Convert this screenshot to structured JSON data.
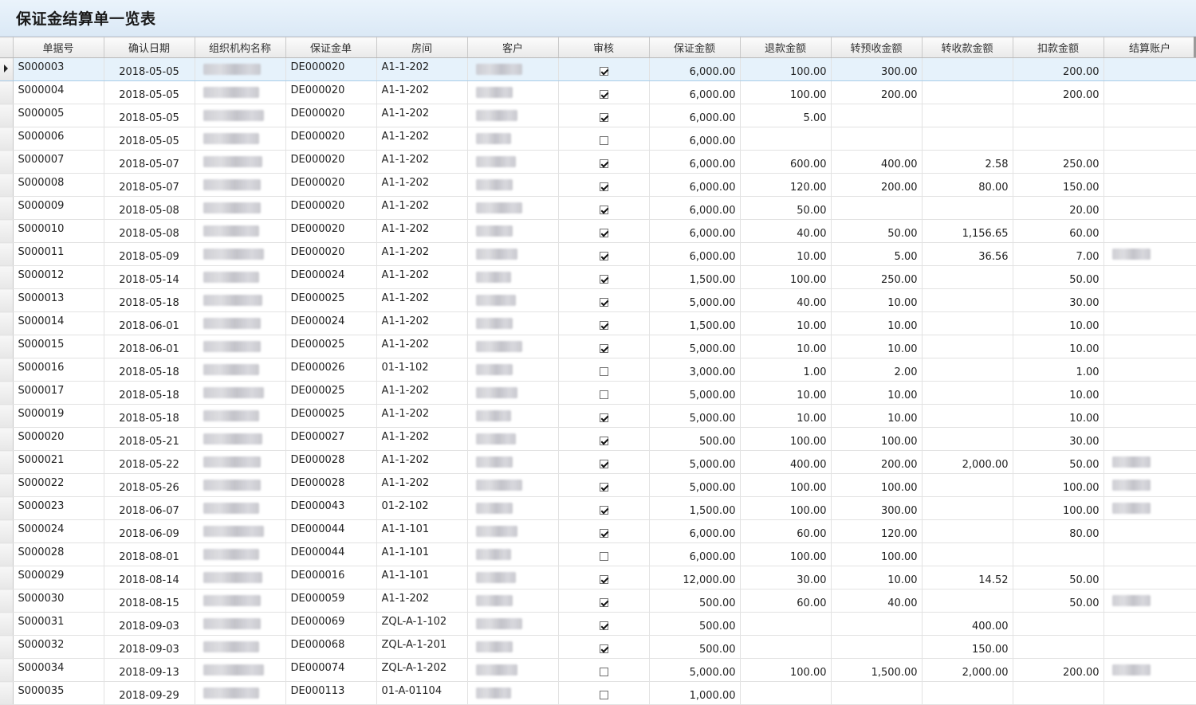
{
  "window": {
    "title": "保证金结算单一览表"
  },
  "columns": [
    "单据号",
    "确认日期",
    "组织机构名称",
    "保证金单",
    "房间",
    "客户",
    "审核",
    "保证金额",
    "退款金额",
    "转预收金额",
    "转收款金额",
    "扣款金额",
    "结算账户"
  ],
  "rows": [
    {
      "code": "S000003",
      "date": "2018-05-05",
      "deposit_no": "DE000020",
      "room": "A1-1-202",
      "approved": true,
      "amount": "6,000.00",
      "refund": "100.00",
      "to_prepaid": "300.00",
      "to_receipt": "",
      "deduct": "200.00",
      "account_masked": false
    },
    {
      "code": "S000004",
      "date": "2018-05-05",
      "deposit_no": "DE000020",
      "room": "A1-1-202",
      "approved": true,
      "amount": "6,000.00",
      "refund": "100.00",
      "to_prepaid": "200.00",
      "to_receipt": "",
      "deduct": "200.00",
      "account_masked": false
    },
    {
      "code": "S000005",
      "date": "2018-05-05",
      "deposit_no": "DE000020",
      "room": "A1-1-202",
      "approved": true,
      "amount": "6,000.00",
      "refund": "5.00",
      "to_prepaid": "",
      "to_receipt": "",
      "deduct": "",
      "account_masked": false
    },
    {
      "code": "S000006",
      "date": "2018-05-05",
      "deposit_no": "DE000020",
      "room": "A1-1-202",
      "approved": false,
      "amount": "6,000.00",
      "refund": "",
      "to_prepaid": "",
      "to_receipt": "",
      "deduct": "",
      "account_masked": false
    },
    {
      "code": "S000007",
      "date": "2018-05-07",
      "deposit_no": "DE000020",
      "room": "A1-1-202",
      "approved": true,
      "amount": "6,000.00",
      "refund": "600.00",
      "to_prepaid": "400.00",
      "to_receipt": "2.58",
      "deduct": "250.00",
      "account_masked": false
    },
    {
      "code": "S000008",
      "date": "2018-05-07",
      "deposit_no": "DE000020",
      "room": "A1-1-202",
      "approved": true,
      "amount": "6,000.00",
      "refund": "120.00",
      "to_prepaid": "200.00",
      "to_receipt": "80.00",
      "deduct": "150.00",
      "account_masked": false
    },
    {
      "code": "S000009",
      "date": "2018-05-08",
      "deposit_no": "DE000020",
      "room": "A1-1-202",
      "approved": true,
      "amount": "6,000.00",
      "refund": "50.00",
      "to_prepaid": "",
      "to_receipt": "",
      "deduct": "20.00",
      "account_masked": false
    },
    {
      "code": "S000010",
      "date": "2018-05-08",
      "deposit_no": "DE000020",
      "room": "A1-1-202",
      "approved": true,
      "amount": "6,000.00",
      "refund": "40.00",
      "to_prepaid": "50.00",
      "to_receipt": "1,156.65",
      "deduct": "60.00",
      "account_masked": false
    },
    {
      "code": "S000011",
      "date": "2018-05-09",
      "deposit_no": "DE000020",
      "room": "A1-1-202",
      "approved": true,
      "amount": "6,000.00",
      "refund": "10.00",
      "to_prepaid": "5.00",
      "to_receipt": "36.56",
      "deduct": "7.00",
      "account_masked": true
    },
    {
      "code": "S000012",
      "date": "2018-05-14",
      "deposit_no": "DE000024",
      "room": "A1-1-202",
      "approved": true,
      "amount": "1,500.00",
      "refund": "100.00",
      "to_prepaid": "250.00",
      "to_receipt": "",
      "deduct": "50.00",
      "account_masked": false
    },
    {
      "code": "S000013",
      "date": "2018-05-18",
      "deposit_no": "DE000025",
      "room": "A1-1-202",
      "approved": true,
      "amount": "5,000.00",
      "refund": "40.00",
      "to_prepaid": "10.00",
      "to_receipt": "",
      "deduct": "30.00",
      "account_masked": false
    },
    {
      "code": "S000014",
      "date": "2018-06-01",
      "deposit_no": "DE000024",
      "room": "A1-1-202",
      "approved": true,
      "amount": "1,500.00",
      "refund": "10.00",
      "to_prepaid": "10.00",
      "to_receipt": "",
      "deduct": "10.00",
      "account_masked": false
    },
    {
      "code": "S000015",
      "date": "2018-06-01",
      "deposit_no": "DE000025",
      "room": "A1-1-202",
      "approved": true,
      "amount": "5,000.00",
      "refund": "10.00",
      "to_prepaid": "10.00",
      "to_receipt": "",
      "deduct": "10.00",
      "account_masked": false
    },
    {
      "code": "S000016",
      "date": "2018-05-18",
      "deposit_no": "DE000026",
      "room": "01-1-102",
      "approved": false,
      "amount": "3,000.00",
      "refund": "1.00",
      "to_prepaid": "2.00",
      "to_receipt": "",
      "deduct": "1.00",
      "account_masked": false
    },
    {
      "code": "S000017",
      "date": "2018-05-18",
      "deposit_no": "DE000025",
      "room": "A1-1-202",
      "approved": false,
      "amount": "5,000.00",
      "refund": "10.00",
      "to_prepaid": "10.00",
      "to_receipt": "",
      "deduct": "10.00",
      "account_masked": false
    },
    {
      "code": "S000019",
      "date": "2018-05-18",
      "deposit_no": "DE000025",
      "room": "A1-1-202",
      "approved": true,
      "amount": "5,000.00",
      "refund": "10.00",
      "to_prepaid": "10.00",
      "to_receipt": "",
      "deduct": "10.00",
      "account_masked": false
    },
    {
      "code": "S000020",
      "date": "2018-05-21",
      "deposit_no": "DE000027",
      "room": "A1-1-202",
      "approved": true,
      "amount": "500.00",
      "refund": "100.00",
      "to_prepaid": "100.00",
      "to_receipt": "",
      "deduct": "30.00",
      "account_masked": false
    },
    {
      "code": "S000021",
      "date": "2018-05-22",
      "deposit_no": "DE000028",
      "room": "A1-1-202",
      "approved": true,
      "amount": "5,000.00",
      "refund": "400.00",
      "to_prepaid": "200.00",
      "to_receipt": "2,000.00",
      "deduct": "50.00",
      "account_masked": true
    },
    {
      "code": "S000022",
      "date": "2018-05-26",
      "deposit_no": "DE000028",
      "room": "A1-1-202",
      "approved": true,
      "amount": "5,000.00",
      "refund": "100.00",
      "to_prepaid": "100.00",
      "to_receipt": "",
      "deduct": "100.00",
      "account_masked": true
    },
    {
      "code": "S000023",
      "date": "2018-06-07",
      "deposit_no": "DE000043",
      "room": "01-2-102",
      "approved": true,
      "amount": "1,500.00",
      "refund": "100.00",
      "to_prepaid": "300.00",
      "to_receipt": "",
      "deduct": "100.00",
      "account_masked": true
    },
    {
      "code": "S000024",
      "date": "2018-06-09",
      "deposit_no": "DE000044",
      "room": "A1-1-101",
      "approved": true,
      "amount": "6,000.00",
      "refund": "60.00",
      "to_prepaid": "120.00",
      "to_receipt": "",
      "deduct": "80.00",
      "account_masked": false
    },
    {
      "code": "S000028",
      "date": "2018-08-01",
      "deposit_no": "DE000044",
      "room": "A1-1-101",
      "approved": false,
      "amount": "6,000.00",
      "refund": "100.00",
      "to_prepaid": "100.00",
      "to_receipt": "",
      "deduct": "",
      "account_masked": false
    },
    {
      "code": "S000029",
      "date": "2018-08-14",
      "deposit_no": "DE000016",
      "room": "A1-1-101",
      "approved": true,
      "amount": "12,000.00",
      "refund": "30.00",
      "to_prepaid": "10.00",
      "to_receipt": "14.52",
      "deduct": "50.00",
      "account_masked": false
    },
    {
      "code": "S000030",
      "date": "2018-08-15",
      "deposit_no": "DE000059",
      "room": "A1-1-202",
      "approved": true,
      "amount": "500.00",
      "refund": "60.00",
      "to_prepaid": "40.00",
      "to_receipt": "",
      "deduct": "50.00",
      "account_masked": true
    },
    {
      "code": "S000031",
      "date": "2018-09-03",
      "deposit_no": "DE000069",
      "room": "ZQL-A-1-102",
      "approved": true,
      "amount": "500.00",
      "refund": "",
      "to_prepaid": "",
      "to_receipt": "400.00",
      "deduct": "",
      "account_masked": false
    },
    {
      "code": "S000032",
      "date": "2018-09-03",
      "deposit_no": "DE000068",
      "room": "ZQL-A-1-201",
      "approved": true,
      "amount": "500.00",
      "refund": "",
      "to_prepaid": "",
      "to_receipt": "150.00",
      "deduct": "",
      "account_masked": false
    },
    {
      "code": "S000034",
      "date": "2018-09-13",
      "deposit_no": "DE000074",
      "room": "ZQL-A-1-202",
      "approved": false,
      "amount": "5,000.00",
      "refund": "100.00",
      "to_prepaid": "1,500.00",
      "to_receipt": "2,000.00",
      "deduct": "200.00",
      "account_masked": true
    },
    {
      "code": "S000035",
      "date": "2018-09-29",
      "deposit_no": "DE000113",
      "room": "01-A-01104",
      "approved": false,
      "amount": "1,000.00",
      "refund": "",
      "to_prepaid": "",
      "to_receipt": "",
      "deduct": "",
      "account_masked": false
    }
  ],
  "selected_row": 0
}
